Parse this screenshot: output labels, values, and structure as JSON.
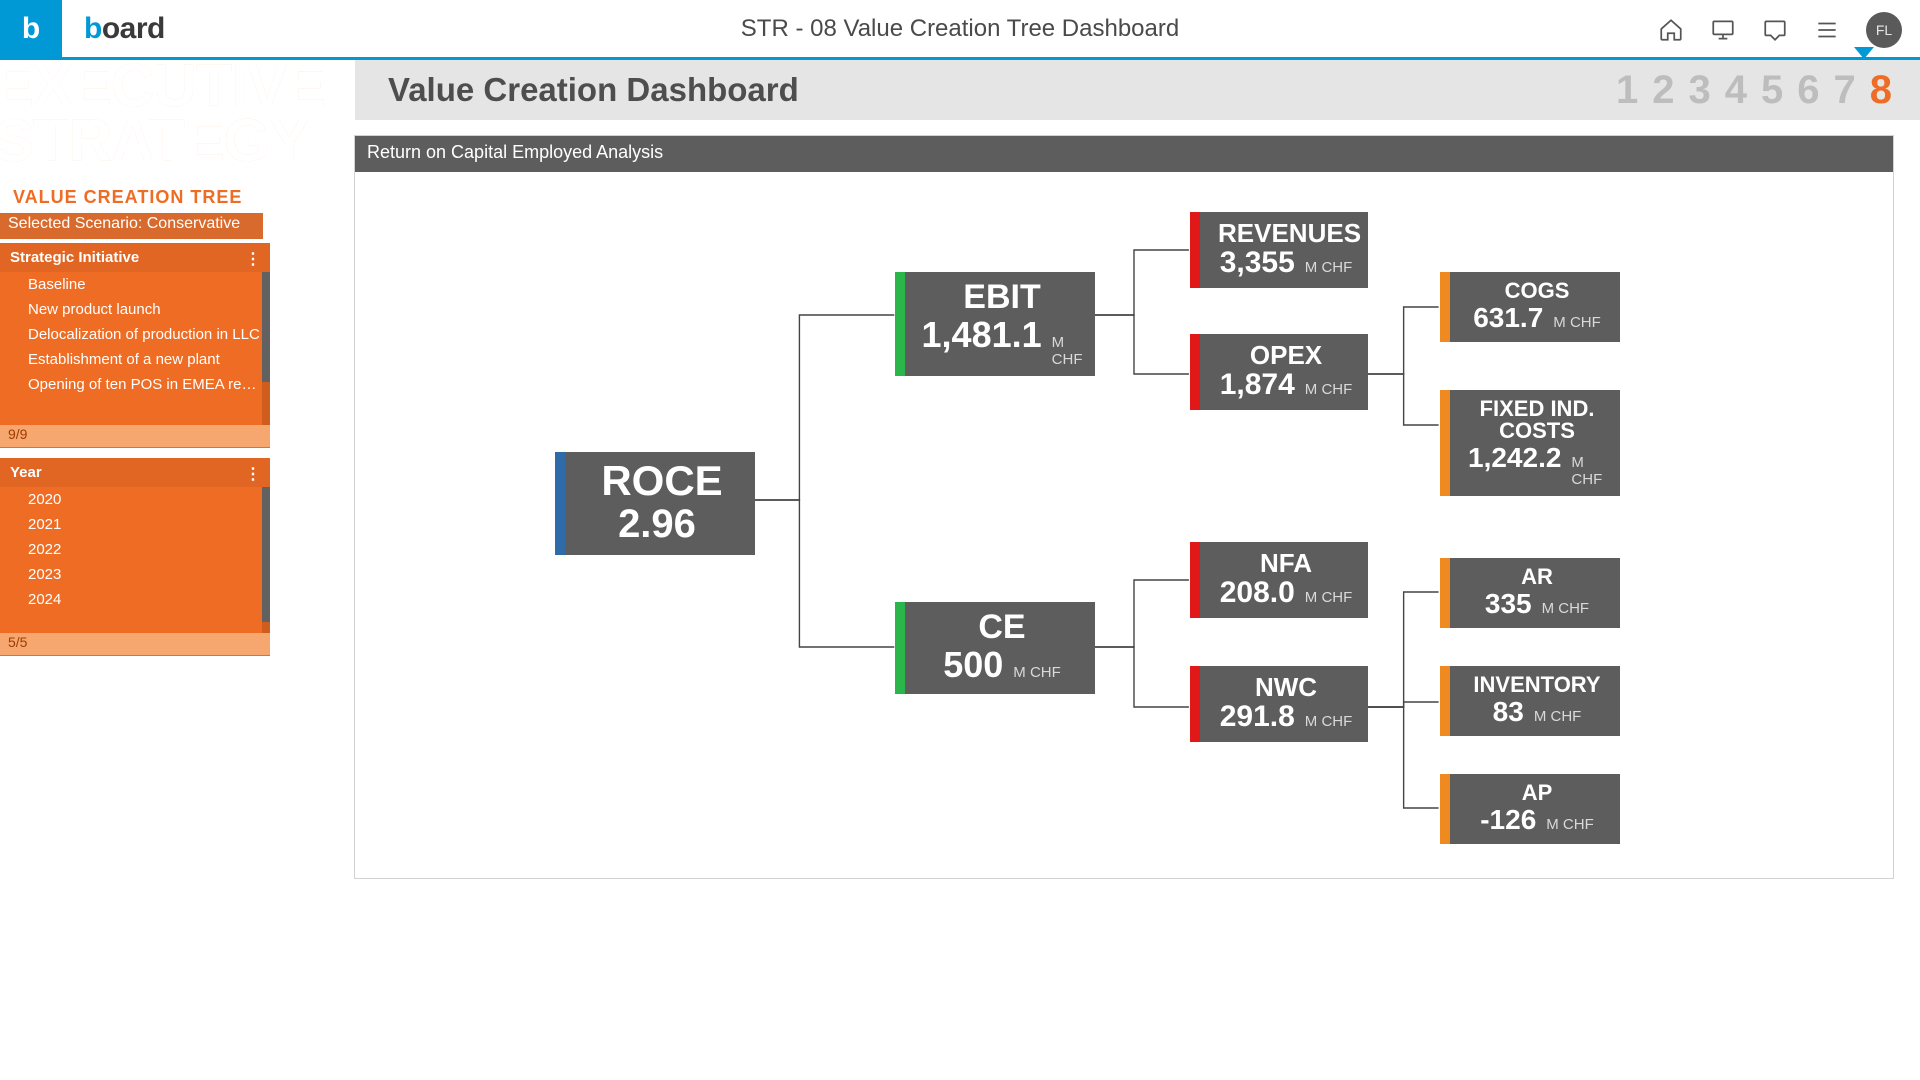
{
  "topbar": {
    "logo_letter": "b",
    "brand": "board",
    "title": "STR - 08 Value Creation Tree Dashboard",
    "avatar": "FL"
  },
  "subheader": {
    "title": "Value Creation Dashboard",
    "pages": [
      "1",
      "2",
      "3",
      "4",
      "5",
      "6",
      "7",
      "8"
    ],
    "active_index": 7
  },
  "sidebar": {
    "exec_line1": "EXECUTIVE",
    "exec_line2": "STRATEGY",
    "tab_label": "VALUE CREATION TREE",
    "scenario": "Selected Scenario: Conservative",
    "initiative": {
      "title": "Strategic Initiative",
      "items": [
        "Baseline",
        "New product launch",
        "Delocalization of production in LLC",
        "Establishment of a new plant",
        "Opening of ten POS in EMEA region"
      ],
      "footer": "9/9"
    },
    "year": {
      "title": "Year",
      "items": [
        "2020",
        "2021",
        "2022",
        "2023",
        "2024"
      ],
      "footer": "5/5"
    }
  },
  "main": {
    "section_title": "Return on Capital Employed Analysis"
  },
  "tree": {
    "unit": "M CHF",
    "nodes": {
      "roce": {
        "label": "ROCE",
        "value": "2.96",
        "unit": "",
        "color": "#2f6aa9"
      },
      "ebit": {
        "label": "EBIT",
        "value": "1,481.1",
        "unit": "M CHF",
        "color": "#2bb54a"
      },
      "ce": {
        "label": "CE",
        "value": "500",
        "unit": "M CHF",
        "color": "#2bb54a"
      },
      "revenues": {
        "label": "REVENUES",
        "value": "3,355",
        "unit": "M CHF",
        "color": "#e01818"
      },
      "opex": {
        "label": "OPEX",
        "value": "1,874",
        "unit": "M CHF",
        "color": "#e01818"
      },
      "nfa": {
        "label": "NFA",
        "value": "208.0",
        "unit": "M CHF",
        "color": "#e01818"
      },
      "nwc": {
        "label": "NWC",
        "value": "291.8",
        "unit": "M CHF",
        "color": "#e01818"
      },
      "cogs": {
        "label": "COGS",
        "value": "631.7",
        "unit": "M CHF",
        "color": "#ee8a1f"
      },
      "fixed": {
        "label": "FIXED IND. COSTS",
        "value": "1,242.2",
        "unit": "M CHF",
        "color": "#ee8a1f"
      },
      "ar": {
        "label": "AR",
        "value": "335",
        "unit": "M CHF",
        "color": "#ee8a1f"
      },
      "inventory": {
        "label": "INVENTORY",
        "value": "83",
        "unit": "M CHF",
        "color": "#ee8a1f"
      },
      "ap": {
        "label": "AP",
        "value": "-126",
        "unit": "M CHF",
        "color": "#ee8a1f"
      }
    }
  }
}
